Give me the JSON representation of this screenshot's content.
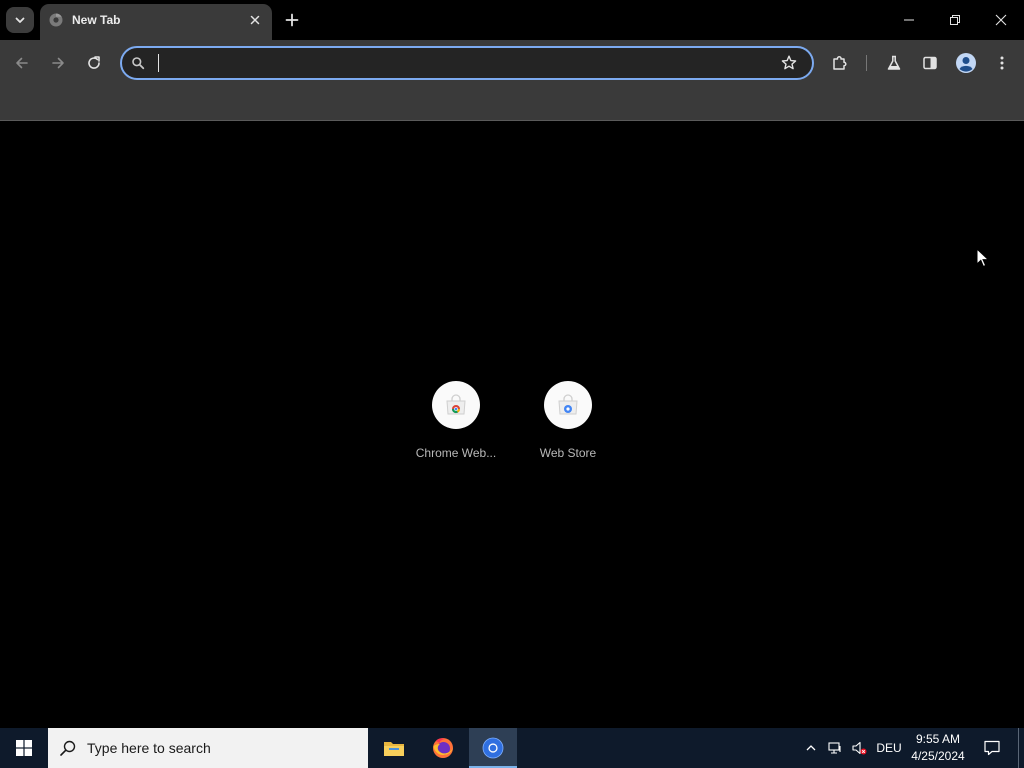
{
  "browser": {
    "tab": {
      "title": "New Tab"
    },
    "omnibox": {
      "value": "",
      "placeholder": ""
    },
    "colors": {
      "accent": "#7caaf0",
      "toolbar": "#3a3a3a",
      "background": "#000000"
    }
  },
  "shortcuts": [
    {
      "label": "Chrome Web...",
      "icon": "chrome-web-store-icon"
    },
    {
      "label": "Web Store",
      "icon": "web-store-icon"
    }
  ],
  "taskbar": {
    "search_placeholder": "Type here to search",
    "apps": [
      "file-explorer-icon",
      "firefox-icon",
      "chrome-icon"
    ],
    "language": "DEU",
    "time": "9:55 AM",
    "date": "4/25/2024"
  }
}
